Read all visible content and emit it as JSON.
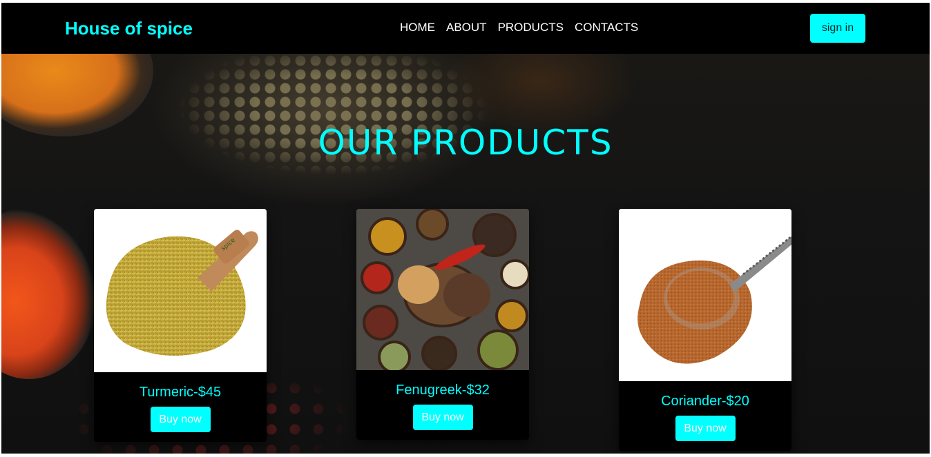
{
  "header": {
    "brand": "House of spice",
    "nav": [
      "HOME",
      "ABOUT",
      "PRODUCTS",
      "CONTACTS"
    ],
    "signin_label": "sign in"
  },
  "hero": {
    "title": "OUR PRODUCTS"
  },
  "products": [
    {
      "title": "Turmeric-$45",
      "button": "Buy now",
      "image": "turmeric-on-scoop"
    },
    {
      "title": "Fenugreek-$32",
      "button": "Buy now",
      "image": "spice-bowls-assortment"
    },
    {
      "title": "Coriander-$20",
      "button": "Buy now",
      "image": "ground-coriander-on-spoon"
    }
  ],
  "colors": {
    "accent": "#00ffff",
    "navbar": "#000000",
    "background": "#0b0b0b"
  }
}
